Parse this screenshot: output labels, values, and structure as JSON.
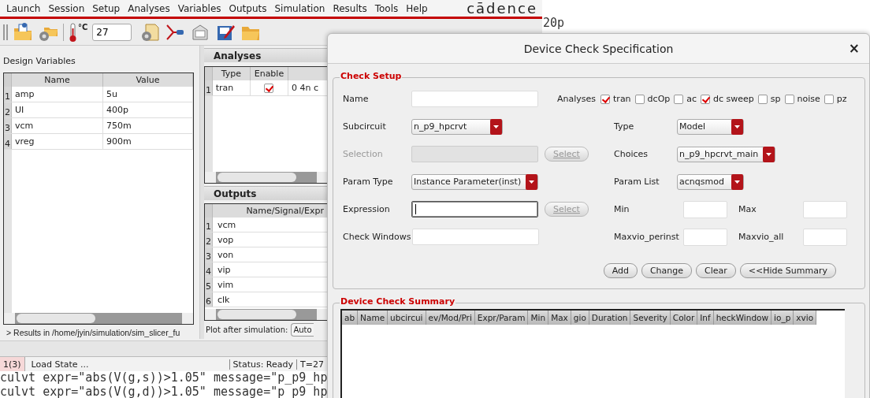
{
  "terminal": {
    "top_lines": [
      "20p"
    ],
    "bottom_lines": [
      "culvt expr=\"abs(V(g,s))>1.05\" message=\"p_p9_hp",
      "culvt expr=\"abs(V(g,d))>1.05\" message=\"p_p9_hp"
    ]
  },
  "menu_bar": {
    "items": [
      "Launch",
      "Session",
      "Setup",
      "Analyses",
      "Variables",
      "Outputs",
      "Simulation",
      "Results",
      "Tools",
      "Help"
    ],
    "logo": "cādence"
  },
  "toolbar": {
    "temperature_unit": "°C",
    "temperature": "27"
  },
  "design_variables": {
    "title": "Design Variables",
    "columns": [
      "Name",
      "Value"
    ],
    "rows": [
      {
        "index": "1",
        "name": "amp",
        "value": "5u"
      },
      {
        "index": "2",
        "name": "UI",
        "value": "400p"
      },
      {
        "index": "3",
        "name": "vcm",
        "value": "750m"
      },
      {
        "index": "4",
        "name": "vreg",
        "value": "900m"
      }
    ]
  },
  "results_line": "> Results in /home/jyin/simulation/sim_slicer_fu",
  "analyses": {
    "title": "Analyses",
    "columns": [
      "Type",
      "Enable"
    ],
    "rows": [
      {
        "index": "1",
        "type": "tran",
        "enabled": true,
        "column_3": "0 4n c"
      }
    ]
  },
  "outputs": {
    "title": "Outputs",
    "columns": [
      "Name/Signal/Expr"
    ],
    "rows": [
      {
        "index": "1",
        "name": "vcm"
      },
      {
        "index": "2",
        "name": "vop"
      },
      {
        "index": "3",
        "name": "von"
      },
      {
        "index": "4",
        "name": "vip"
      },
      {
        "index": "5",
        "name": "vim"
      },
      {
        "index": "6",
        "name": "clk"
      }
    ]
  },
  "plot_after": {
    "label": "Plot after simulation:",
    "value": "Auto"
  },
  "status_bar": {
    "count": "1(3)",
    "message": "Load State ...",
    "status": "Status: Ready",
    "temperature": "T=27"
  },
  "dialog": {
    "title": "Device Check Specification",
    "close": "×",
    "check_setup": {
      "title": "Check Setup",
      "rows": [
        {
          "left": {
            "label": "Name",
            "kind": "input",
            "disabled": false,
            "focused": false
          },
          "right": {
            "kind": "checkboxes",
            "label": "Analyses",
            "options": [
              {
                "label": "tran",
                "checked": true
              },
              {
                "label": "dcOp",
                "checked": false
              },
              {
                "label": "ac",
                "checked": false
              },
              {
                "label": "dc sweep",
                "checked": true
              },
              {
                "label": "sp",
                "checked": false
              },
              {
                "label": "noise",
                "checked": false
              },
              {
                "label": "pz",
                "checked": false
              }
            ]
          }
        },
        {
          "left": {
            "label": "Subcircuit",
            "kind": "dropdown",
            "value": "n_p9_hpcrvt",
            "disabled": false
          },
          "right": {
            "kind": "dropdown",
            "label": "Type",
            "value": "Model"
          }
        },
        {
          "left": {
            "label": "Selection",
            "kind": "input",
            "disabled": true,
            "focused": false,
            "button": {
              "label": "Select",
              "disabled": true
            }
          },
          "right": {
            "kind": "dropdown",
            "label": "Choices",
            "value": "n_p9_hpcrvt_main"
          }
        },
        {
          "left": {
            "label": "Param Type",
            "kind": "dropdown",
            "value": "Instance Parameter(inst)",
            "disabled": false
          },
          "right": {
            "kind": "dropdown",
            "label": "Param List",
            "value": "acnqsmod"
          }
        },
        {
          "left": {
            "label": "Expression",
            "kind": "input",
            "disabled": false,
            "focused": true,
            "button": {
              "label": "Select",
              "disabled": true
            }
          },
          "right": {
            "kind": "pair",
            "fields": [
              {
                "label": "Min"
              },
              {
                "label": "Max"
              }
            ]
          }
        },
        {
          "left": {
            "label": "Check Windows",
            "kind": "input",
            "disabled": false,
            "focused": false
          },
          "right": {
            "kind": "pair",
            "fields": [
              {
                "label": "Maxvio_perinst"
              },
              {
                "label": "Maxvio_all"
              }
            ]
          }
        }
      ],
      "buttons": [
        "Add",
        "Change",
        "Clear",
        "<<Hide Summary"
      ]
    },
    "summary": {
      "title": "Device Check Summary",
      "columns": [
        "ab",
        "Name",
        "ubcircui",
        "ev/Mod/Pri",
        "Expr/Param",
        "Min",
        "Max",
        "gio",
        "Duration",
        "Severity",
        "Color",
        "Inf",
        "heckWindow",
        "io_p",
        "xvio"
      ]
    }
  }
}
